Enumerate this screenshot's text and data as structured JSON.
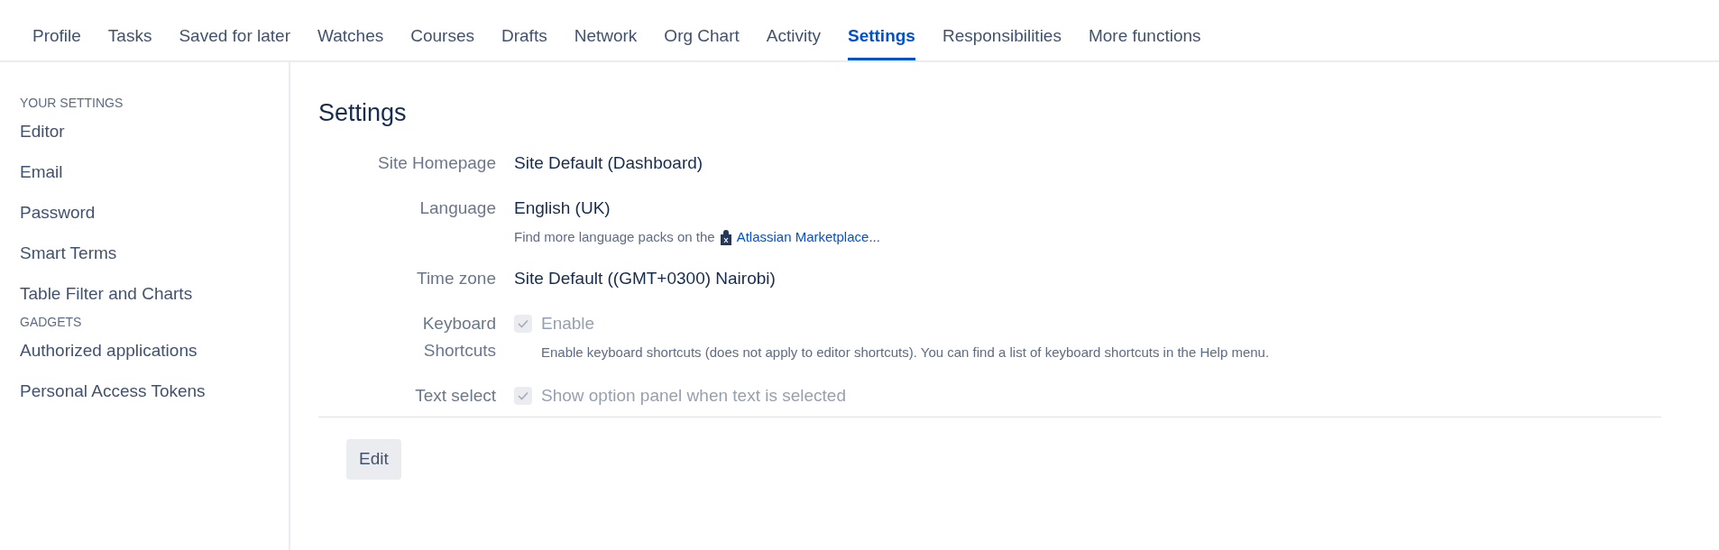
{
  "tabs": [
    {
      "label": "Profile",
      "selected": false
    },
    {
      "label": "Tasks",
      "selected": false
    },
    {
      "label": "Saved for later",
      "selected": false
    },
    {
      "label": "Watches",
      "selected": false
    },
    {
      "label": "Courses",
      "selected": false
    },
    {
      "label": "Drafts",
      "selected": false
    },
    {
      "label": "Network",
      "selected": false
    },
    {
      "label": "Org Chart",
      "selected": false
    },
    {
      "label": "Activity",
      "selected": false
    },
    {
      "label": "Settings",
      "selected": true
    },
    {
      "label": "Responsibilities",
      "selected": false
    },
    {
      "label": "More functions",
      "selected": false
    }
  ],
  "sidebar": {
    "sections": [
      {
        "heading": "YOUR SETTINGS",
        "items": [
          "Editor",
          "Email",
          "Password",
          "Smart Terms",
          "Table Filter and Charts"
        ]
      },
      {
        "heading": "GADGETS",
        "items": [
          "Authorized applications",
          "Personal Access Tokens"
        ]
      }
    ]
  },
  "settings": {
    "title": "Settings",
    "rows": [
      {
        "kind": "text",
        "label": "Site Homepage",
        "value": "Site Default (Dashboard)"
      },
      {
        "kind": "text",
        "label": "Language",
        "value": "English (UK)",
        "hint": "Find more language packs on the",
        "link": "Atlassian Marketplace..."
      },
      {
        "kind": "text",
        "label": "Time zone",
        "value": "Site Default ((GMT+0300) Nairobi)"
      },
      {
        "kind": "checkbox",
        "label": "Keyboard Shortcuts",
        "value": "Enable",
        "checked": true,
        "disabled": true,
        "hint": "Enable keyboard shortcuts (does not apply to editor shortcuts). You can find a list of keyboard shortcuts in the Help menu."
      },
      {
        "kind": "checkbox",
        "label": "Text select",
        "value": "Show option panel when text is selected",
        "checked": true,
        "disabled": true
      }
    ],
    "button": "Edit"
  }
}
